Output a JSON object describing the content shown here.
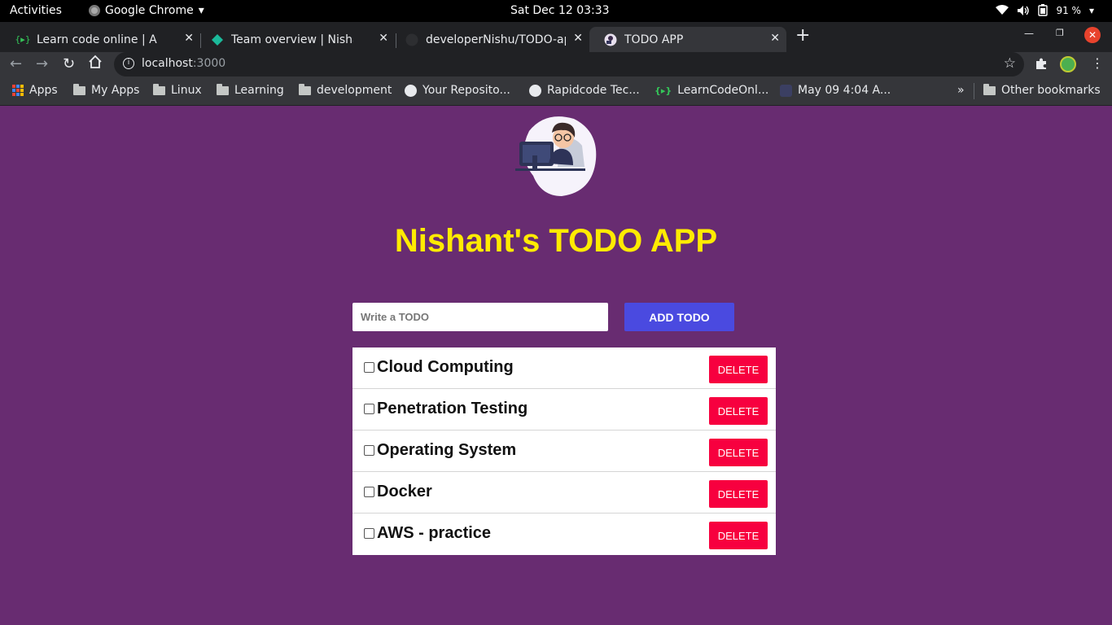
{
  "system": {
    "activities": "Activities",
    "app_name": "Google Chrome",
    "clock": "Sat Dec 12  03:33",
    "battery": "91 %"
  },
  "tabs": [
    {
      "title": "Learn code online | A com",
      "favicon": "learncode-icon"
    },
    {
      "title": "Team overview | Nishant S",
      "favicon": "team-icon"
    },
    {
      "title": "developerNishu/TODO-ap",
      "favicon": "github-icon"
    },
    {
      "title": "TODO APP",
      "favicon": "todo-app-icon",
      "active": true
    }
  ],
  "address_bar": {
    "host": "localhost",
    "port": ":3000"
  },
  "bookmarks": [
    {
      "label": "Apps",
      "icon": "apps-grid-icon"
    },
    {
      "label": "My Apps",
      "icon": "folder-icon"
    },
    {
      "label": "Linux",
      "icon": "folder-icon"
    },
    {
      "label": "Learning",
      "icon": "folder-icon"
    },
    {
      "label": "development",
      "icon": "folder-icon"
    },
    {
      "label": "Your Reposito...",
      "icon": "github-icon"
    },
    {
      "label": "Rapidcode Tec...",
      "icon": "github-icon"
    },
    {
      "label": "LearnCodeOnl...",
      "icon": "learncode-icon"
    },
    {
      "label": "May 09 4:04 A...",
      "icon": "page-icon"
    }
  ],
  "bookmarks_more": "»",
  "other_bookmarks": "Other bookmarks",
  "app": {
    "title": "Nishant's TODO APP",
    "input_placeholder": "Write a TODO",
    "add_button": "ADD TODO",
    "delete_label": "DELETE",
    "todos": [
      {
        "text": "Cloud Computing",
        "done": false
      },
      {
        "text": "Penetration Testing",
        "done": false
      },
      {
        "text": "Operating System",
        "done": false
      },
      {
        "text": "Docker",
        "done": false
      },
      {
        "text": "AWS - practice",
        "done": false
      }
    ]
  },
  "colors": {
    "page_bg": "#682c71",
    "title": "#ffeb00",
    "add_button": "#4a4ae0",
    "delete_button": "#f7003f"
  }
}
